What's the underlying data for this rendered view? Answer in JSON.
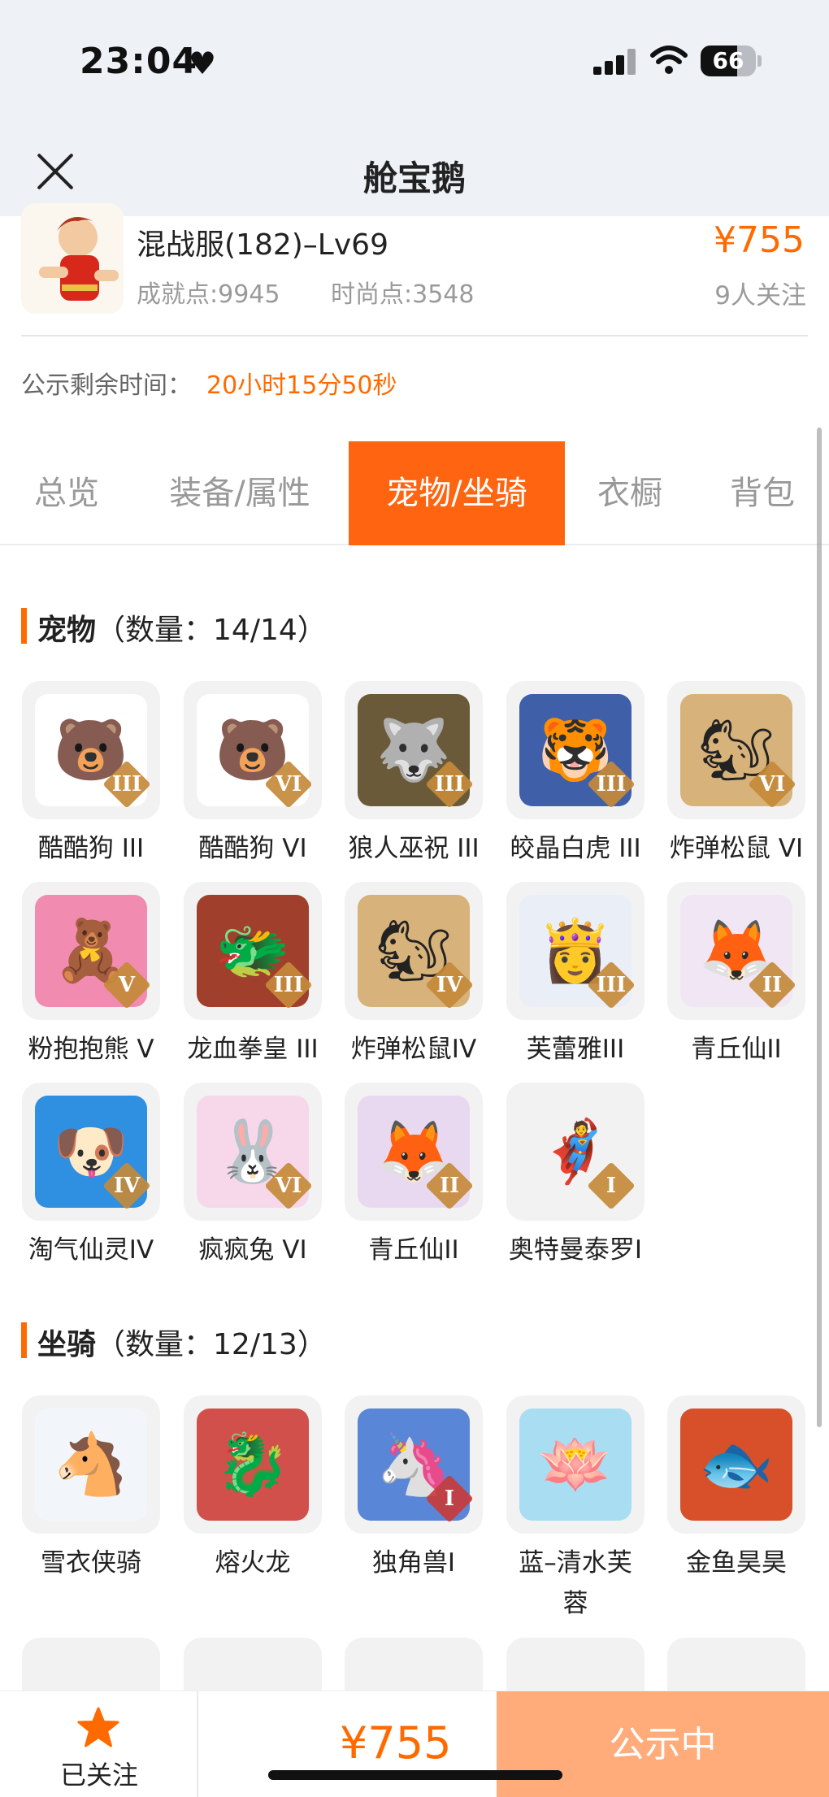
{
  "status_bar": {
    "time": "23:04",
    "battery": "66",
    "battery_level_percent": 66
  },
  "nav": {
    "title": "舱宝鹅"
  },
  "product": {
    "name": "混战服(182)–Lv69",
    "achievement": "成就点:9945",
    "fashion": "时尚点:3548",
    "price": "¥755",
    "followers": "9人关注"
  },
  "countdown": {
    "label": "公示剩余时间：",
    "value": "20小时15分50秒"
  },
  "tabs": [
    {
      "label": "总览"
    },
    {
      "label": "装备/属性"
    },
    {
      "label": "宠物/坐骑"
    },
    {
      "label": "衣橱"
    },
    {
      "label": "背包"
    }
  ],
  "active_tab": "宠物/坐骑",
  "pets": {
    "title": "宠物",
    "count": "（数量：14/14）",
    "items": [
      {
        "label": "酷酷狗 III",
        "rank": "III",
        "icon": "bear-goggles-icon",
        "bg": "#ffffff"
      },
      {
        "label": "酷酷狗 VI",
        "rank": "VI",
        "icon": "bear-goggles-icon",
        "bg": "#ffffff"
      },
      {
        "label": "狼人巫祝 III",
        "rank": "III",
        "icon": "werewolf-icon",
        "bg": "#6a5a3a"
      },
      {
        "label": "皎晶白虎 III",
        "rank": "III",
        "icon": "white-tiger-icon",
        "bg": "#3f5fa8"
      },
      {
        "label": "炸弹松鼠 VI",
        "rank": "VI",
        "icon": "squirrel-icon",
        "bg": "#d7b27a"
      },
      {
        "label": "粉抱抱熊 V",
        "rank": "V",
        "icon": "pink-bear-icon",
        "bg": "#f28bb0"
      },
      {
        "label": "龙血拳皇 III",
        "rank": "III",
        "icon": "dragon-fist-icon",
        "bg": "#a0402c"
      },
      {
        "label": "炸弹松鼠IV",
        "rank": "IV",
        "icon": "squirrel-icon",
        "bg": "#d7b27a"
      },
      {
        "label": "芙蕾雅III",
        "rank": "III",
        "icon": "freya-icon",
        "bg": "#e9eef7"
      },
      {
        "label": "青丘仙II",
        "rank": "II",
        "icon": "fox-fairy-icon",
        "bg": "#f1e6f4"
      },
      {
        "label": "淘气仙灵IV",
        "rank": "IV",
        "icon": "blue-imp-icon",
        "bg": "#2f8fe0"
      },
      {
        "label": "疯疯兔 VI",
        "rank": "VI",
        "icon": "crazy-rabbit-icon",
        "bg": "#f6d8ea"
      },
      {
        "label": "青丘仙II",
        "rank": "II",
        "icon": "fox-fairy-icon",
        "bg": "#e8d9f0"
      },
      {
        "label": "奥特曼泰罗I",
        "rank": "I",
        "icon": "ultraman-icon",
        "bg": "#f2f2f2"
      }
    ]
  },
  "mounts": {
    "title": "坐骑",
    "count": "（数量：12/13）",
    "items": [
      {
        "label": "雪衣侠骑",
        "rank": "",
        "icon": "white-horse-icon",
        "bg": "#f2f6fb"
      },
      {
        "label": "熔火龙",
        "rank": "",
        "icon": "fire-dragon-icon",
        "bg": "#d2504c"
      },
      {
        "label": "独角兽I",
        "rank": "I",
        "icon": "unicorn-icon",
        "bg": "#5a86d8"
      },
      {
        "label": "蓝–清水芙蓉",
        "rank": "",
        "icon": "blue-lotus-icon",
        "bg": "#a9def2"
      },
      {
        "label": "金鱼昊昊",
        "rank": "",
        "icon": "goldfish-icon",
        "bg": "#d8502a"
      }
    ]
  },
  "bottom": {
    "follow_label": "已关注",
    "price": "¥755",
    "status_label": "公示中"
  }
}
